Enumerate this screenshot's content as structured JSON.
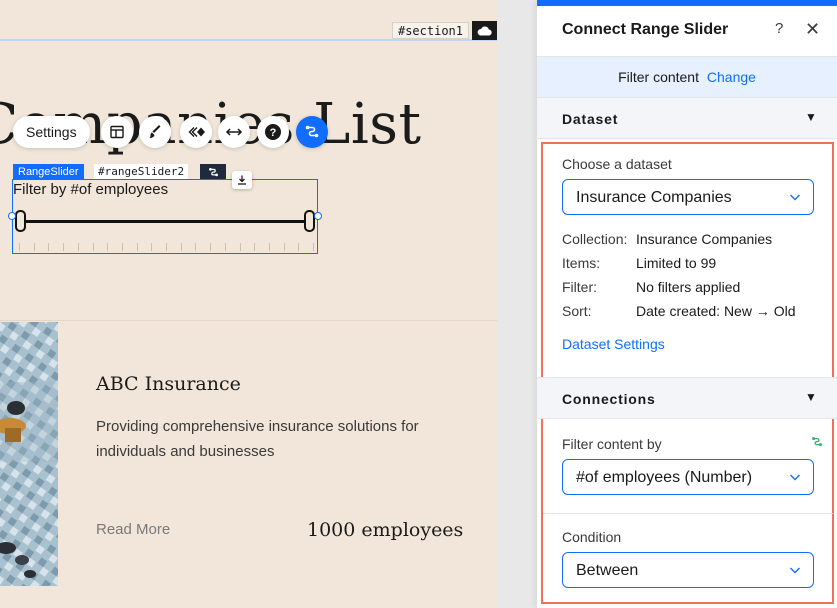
{
  "canvas": {
    "section_tag": "#section1",
    "heading": "r Companies List",
    "toolbar": {
      "settings_label": "Settings"
    },
    "component": {
      "type_tag": "RangeSlider",
      "id_tag": "#rangeSlider2",
      "label": "Filter by #of employees"
    },
    "card": {
      "title": "ABC Insurance",
      "description": "Providing comprehensive insurance solutions for individuals and businesses",
      "read_more": "Read More",
      "employees": "1000 employees"
    }
  },
  "panel": {
    "title": "Connect Range Slider",
    "help": "?",
    "close": "✕",
    "filter_bar": {
      "text": "Filter content",
      "link": "Change"
    },
    "dataset_section": {
      "title": "Dataset",
      "choose_label": "Choose a dataset",
      "selected_dataset": "Insurance Companies",
      "info": [
        {
          "key": "Collection:",
          "value": "Insurance Companies"
        },
        {
          "key": "Items:",
          "value": "Limited to 99"
        },
        {
          "key": "Filter:",
          "value": "No filters applied"
        },
        {
          "key": "Sort:",
          "value": "Date created: New → Old"
        }
      ],
      "settings_link": "Dataset Settings"
    },
    "connections_section": {
      "title": "Connections",
      "filter_by_label": "Filter content by",
      "filter_by_value": "#of employees (Number)",
      "condition_label": "Condition",
      "condition_value": "Between"
    }
  },
  "colors": {
    "accent": "#116dff",
    "canvas_bg": "#f1e6d9",
    "highlight": "#f0705a",
    "connect_green": "#2fb36b"
  }
}
